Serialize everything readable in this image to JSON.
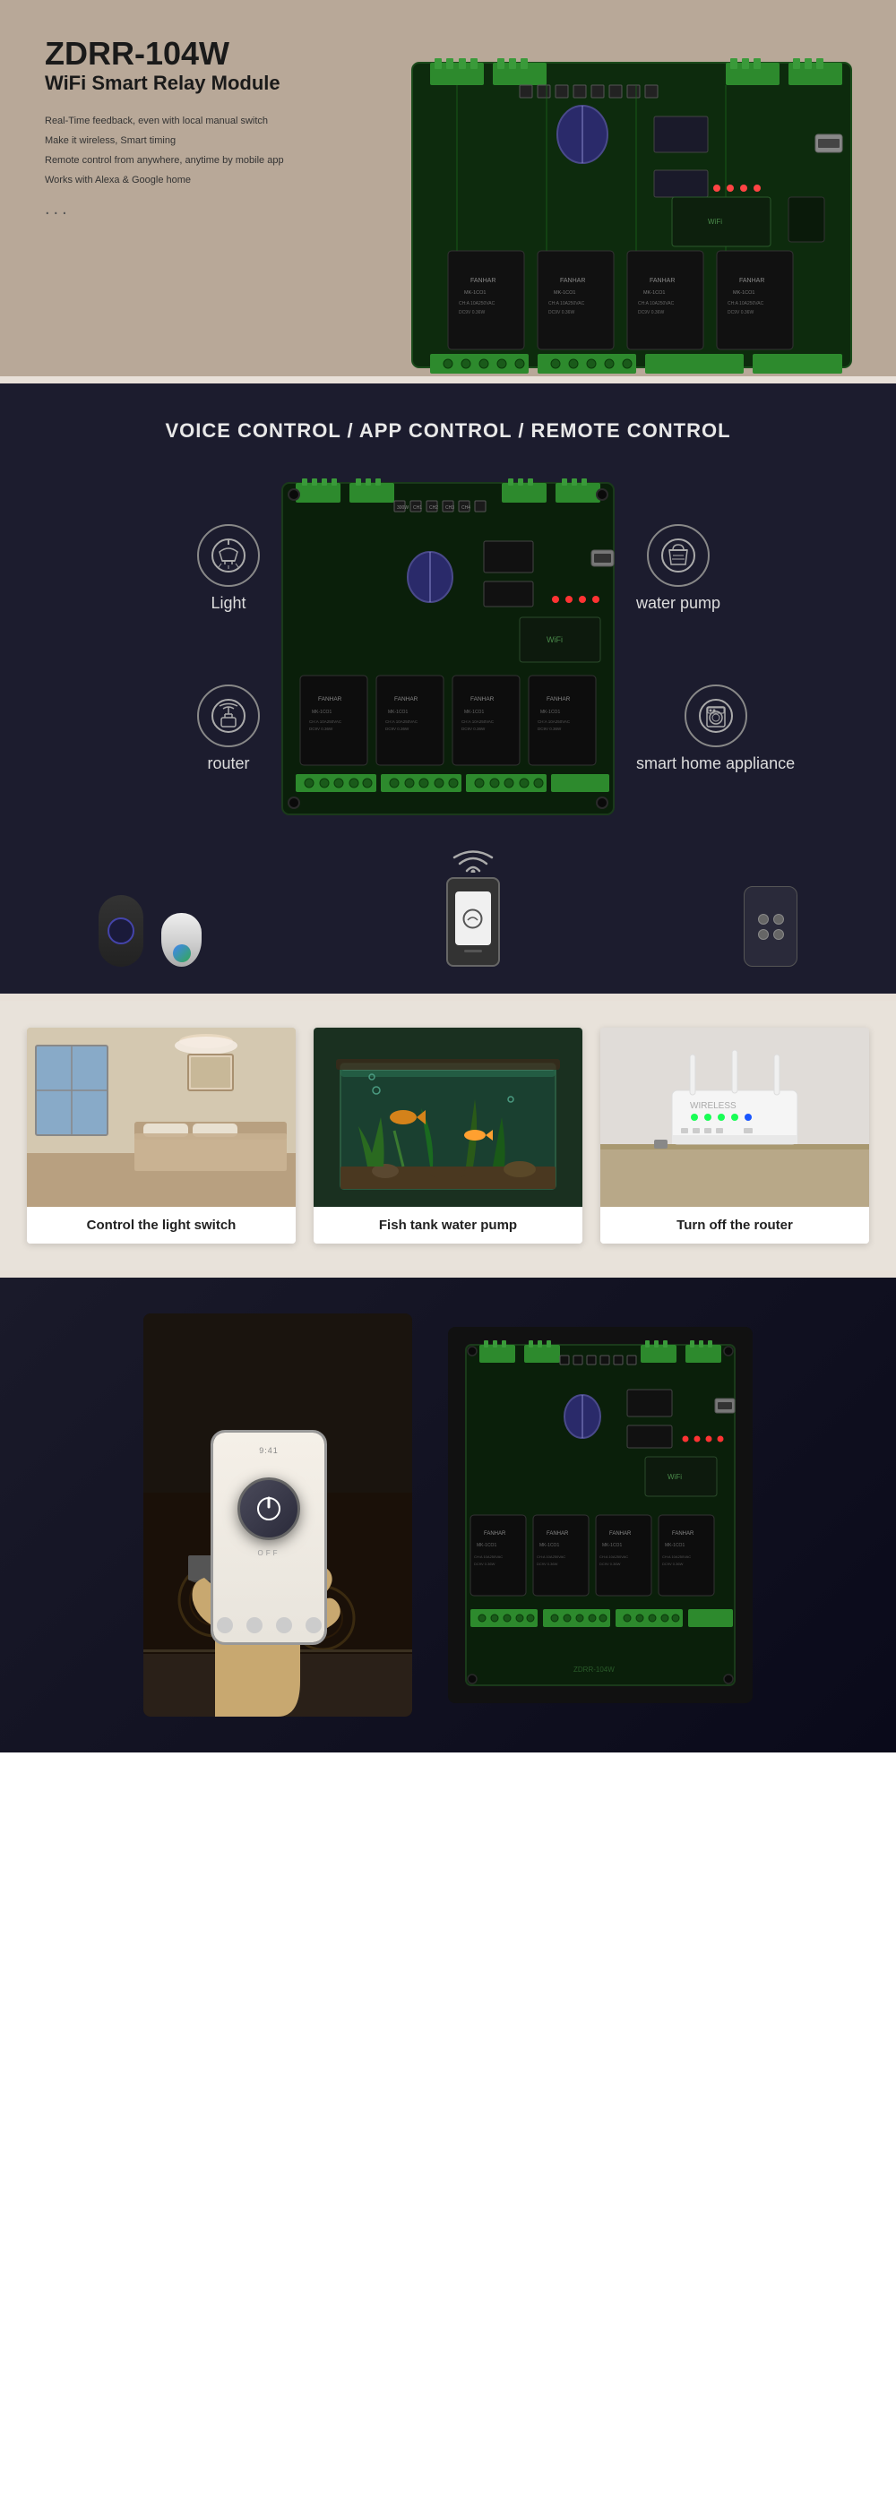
{
  "hero": {
    "model": "ZDRR-104W",
    "title": "WiFi Smart Relay Module",
    "features": [
      "Real-Time feedback, even with local manual switch",
      "Make it wireless, Smart timing",
      "Remote control from anywhere, anytime by mobile app",
      "Works with Alexa & Google home"
    ],
    "dots": "...",
    "wifi_icon": "📶"
  },
  "control_section": {
    "title": "VOICE CONTROL / APP CONTROL / REMOTE CONTROL",
    "icons": {
      "light_label": "Light",
      "water_pump_label": "water pump",
      "router_label": "router",
      "smart_home_label": "smart home appliance"
    }
  },
  "photo_cards": [
    {
      "caption": "Control the light switch",
      "alt": "Room with ceiling light"
    },
    {
      "caption": "Fish tank water pump",
      "alt": "Fish tank aquarium"
    },
    {
      "caption": "Turn off the router",
      "alt": "WiFi router"
    }
  ],
  "app_section": {
    "power_label": "OFF",
    "wifi_symbol": "((·))"
  }
}
